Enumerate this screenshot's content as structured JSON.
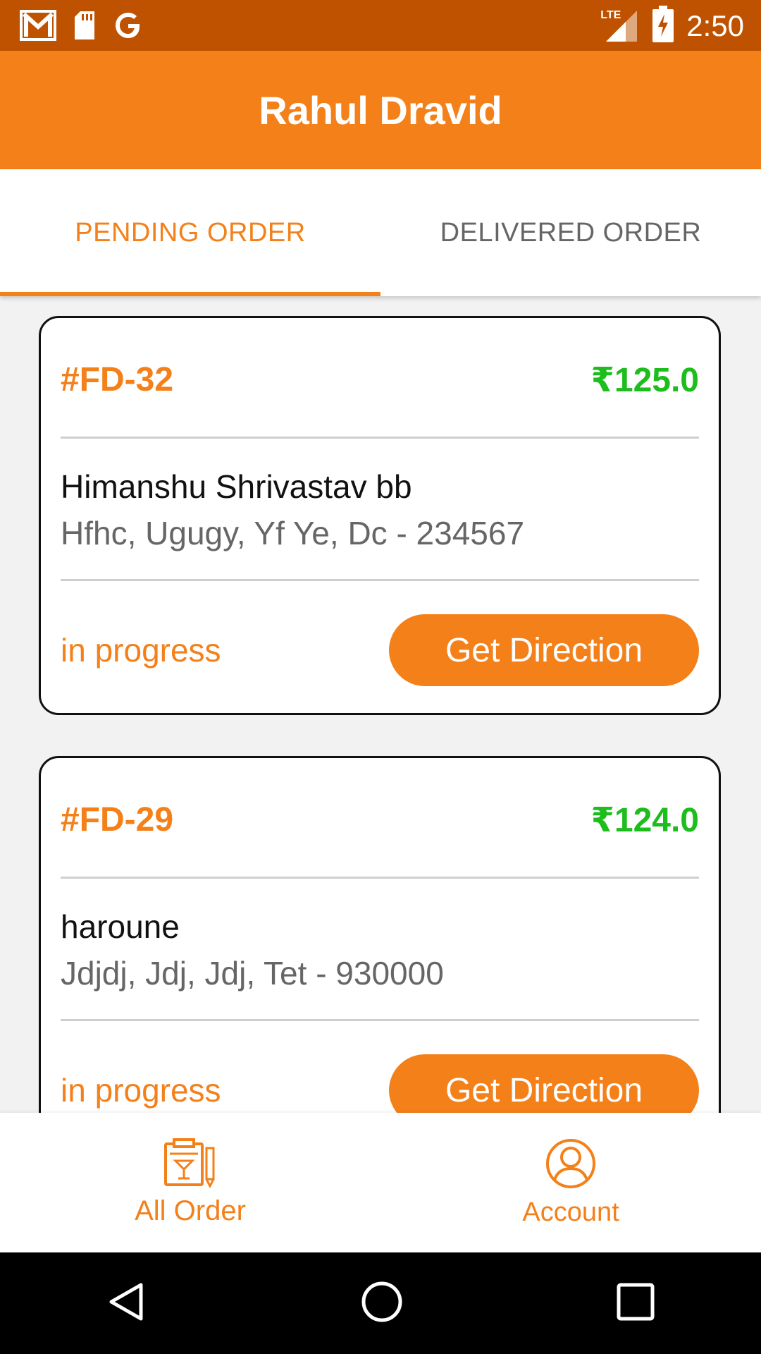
{
  "status_bar": {
    "time": "2:50",
    "network": "LTE",
    "icons": [
      "gmail-icon",
      "sd-card-icon",
      "google-icon",
      "signal-icon",
      "battery-charging-icon"
    ]
  },
  "app_bar": {
    "title": "Rahul Dravid"
  },
  "tabs": [
    {
      "label": "PENDING ORDER",
      "active": true
    },
    {
      "label": "DELIVERED ORDER",
      "active": false
    }
  ],
  "orders": [
    {
      "id": "#FD-32",
      "amount": "₹125.0",
      "customer": "Himanshu Shrivastav bb",
      "address": "Hfhc, Ugugy, Yf Ye, Dc - 234567",
      "status": "in progress",
      "action": "Get Direction"
    },
    {
      "id": "#FD-29",
      "amount": "₹124.0",
      "customer": "haroune",
      "address": "Jdjdj, Jdj, Jdj, Tet - 930000",
      "status": "in progress",
      "action": "Get Direction"
    }
  ],
  "bottom_nav": [
    {
      "label": "All Order",
      "icon": "order-clipboard-icon"
    },
    {
      "label": "Account",
      "icon": "account-circle-icon"
    }
  ],
  "colors": {
    "primary": "#f4801a",
    "status_bar": "#bf5200",
    "price": "#1dbd1d",
    "muted_text": "#666666"
  }
}
